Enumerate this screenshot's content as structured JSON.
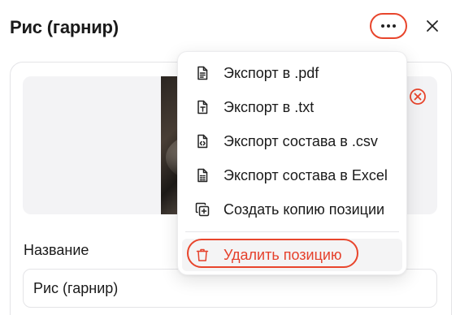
{
  "header": {
    "title": "Рис (гарнир)",
    "more_icon": "ellipsis-horizontal-icon",
    "close_icon": "close-icon"
  },
  "image": {
    "remove_icon": "remove-circle-icon"
  },
  "form": {
    "name_label": "Название",
    "name_value": "Рис (гарнир)"
  },
  "menu": {
    "items": [
      {
        "label": "Экспорт в .pdf",
        "icon": "file-text-icon"
      },
      {
        "label": "Экспорт в .txt",
        "icon": "file-type-icon"
      },
      {
        "label": "Экспорт состава в .csv",
        "icon": "file-code-icon"
      },
      {
        "label": "Экспорт состава в Excel",
        "icon": "file-spreadsheet-icon"
      },
      {
        "label": "Создать копию позиции",
        "icon": "copy-plus-icon"
      }
    ],
    "delete": {
      "label": "Удалить позицию",
      "icon": "trash-icon"
    }
  },
  "colors": {
    "accent_red": "#e8452c",
    "danger_text": "#e5402b",
    "border": "#e4e4e7"
  }
}
